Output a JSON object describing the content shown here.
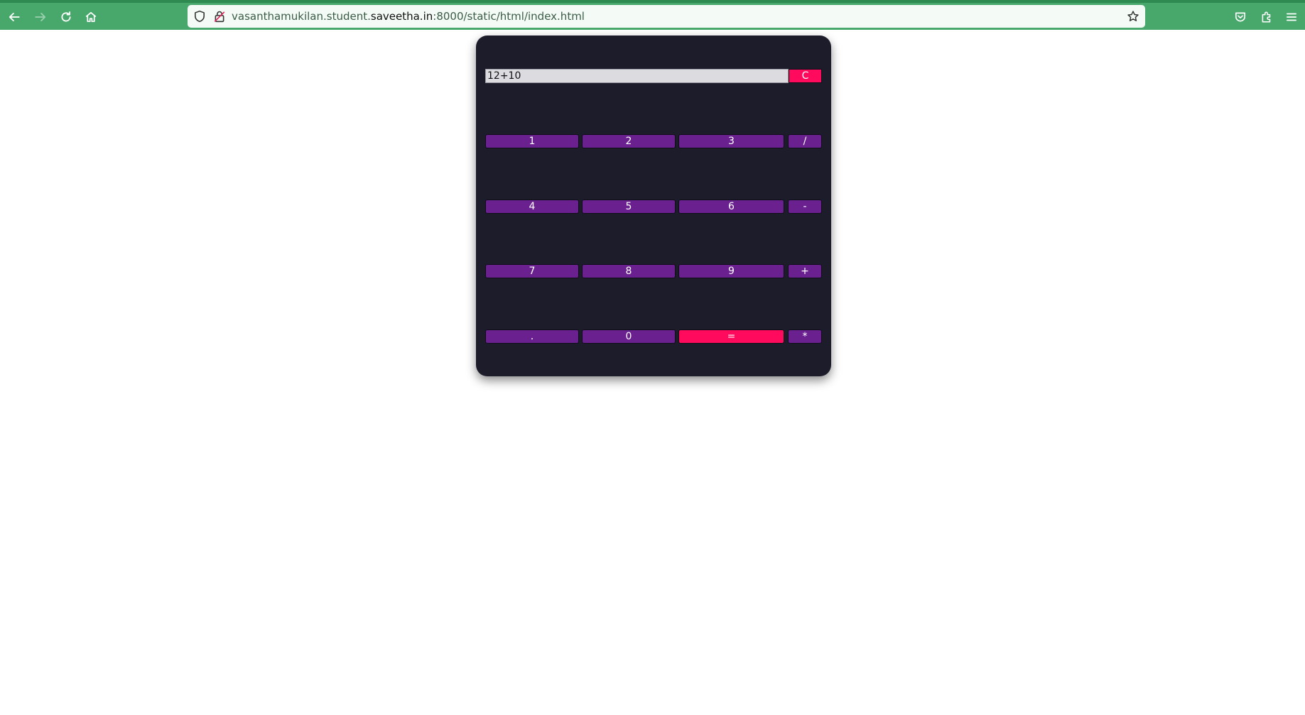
{
  "browser": {
    "url_prefix": "vasanthamukilan.student.",
    "url_host": "saveetha.in",
    "url_suffix": ":8000/static/html/index.html"
  },
  "calculator": {
    "display_value": "12+10",
    "clear_label": "C",
    "keys": {
      "k1": "1",
      "k2": "2",
      "k3": "3",
      "divide": "/",
      "k4": "4",
      "k5": "5",
      "k6": "6",
      "minus": "-",
      "k7": "7",
      "k8": "8",
      "k9": "9",
      "plus": "+",
      "dot": ".",
      "k0": "0",
      "equals": "=",
      "multiply": "*"
    },
    "colors": {
      "panel": "#1c1c2b",
      "key": "#6b2090",
      "accent": "#ff0a5c"
    }
  },
  "colors": {
    "toolbar": "#48a86b"
  }
}
